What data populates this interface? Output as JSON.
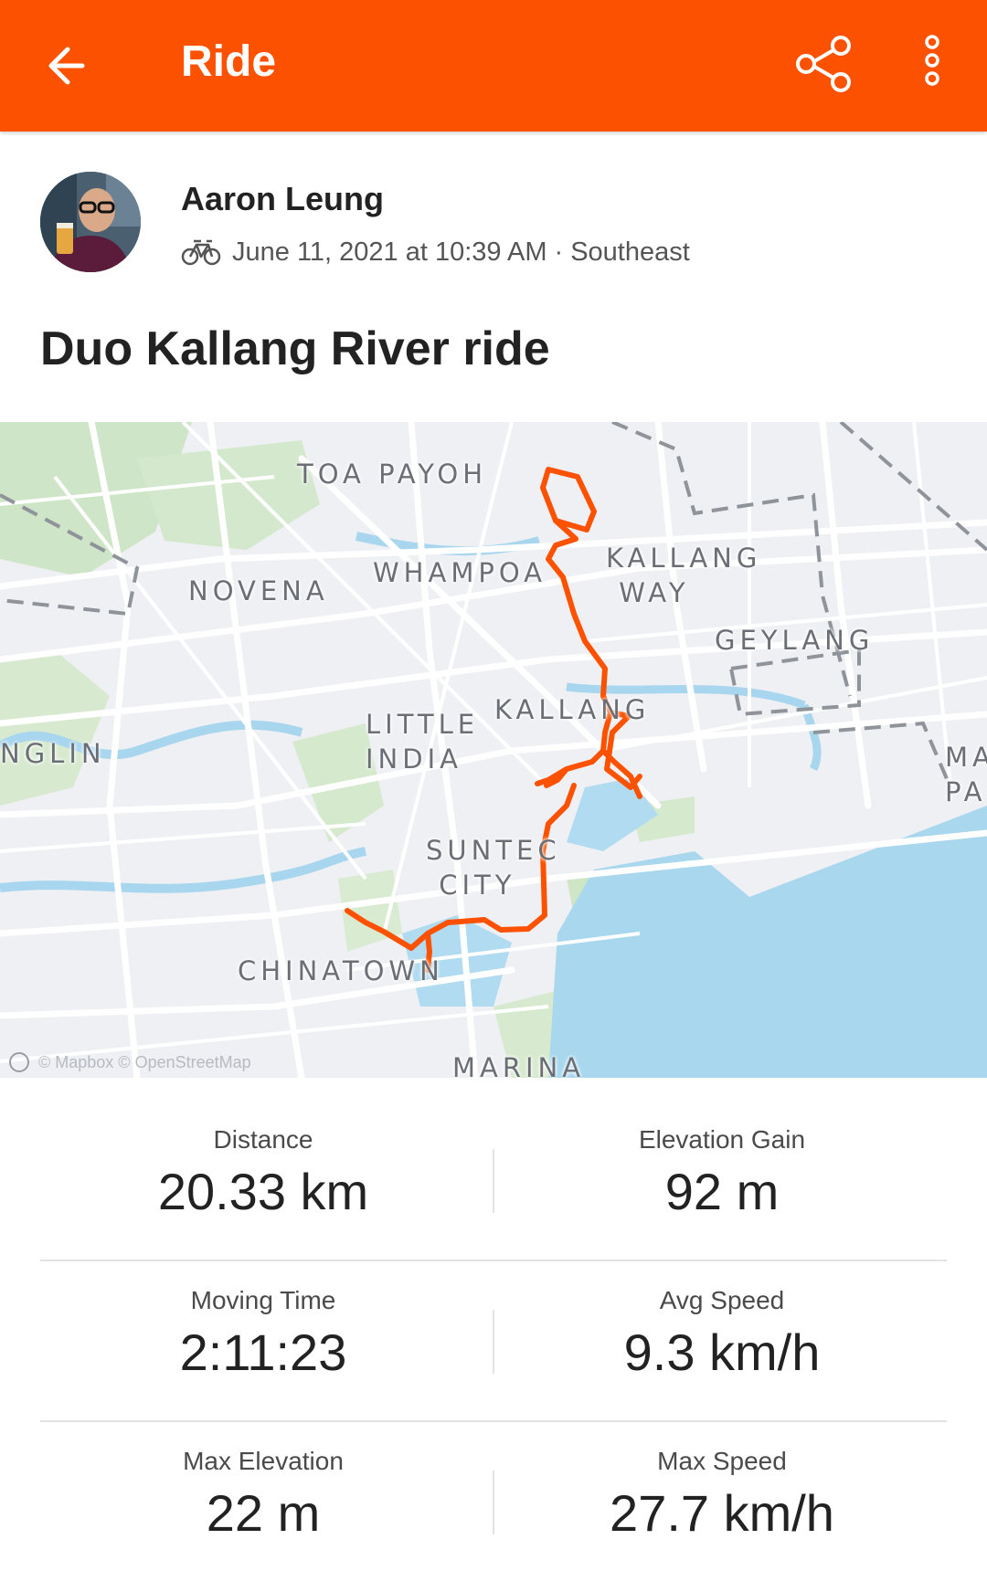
{
  "appbar": {
    "title": "Ride",
    "icons": [
      "back-arrow-icon",
      "share-icon",
      "more-vertical-icon"
    ],
    "color": "#fc5200"
  },
  "athlete": {
    "name": "Aaron Leung",
    "sport_icon": "bike-icon",
    "date": "June 11, 2021 at 10:39 AM",
    "separator": "·",
    "location": "Southeast"
  },
  "activity": {
    "title": "Duo Kallang River ride"
  },
  "map": {
    "labels": {
      "toa_payoh": "TOA PAYOH",
      "novena": "NOVENA",
      "whampoa": "WHAMPOA",
      "kallang_way": "KALLANG\n WAY",
      "geylang": "GEYLANG",
      "kallang": "KALLANG",
      "little_india": "LITTLE\nINDIA",
      "bukit_timah_edge": "NGLIN",
      "suntec_city": "SUNTEC\n CITY",
      "chinatown": "CHINATOWN",
      "marina_edge": "MARINA",
      "marine_parade_edge": "MA\nPA"
    },
    "credit": "© Mapbox © OpenStreetMap",
    "route_color": "#fc5200"
  },
  "stats": {
    "distance": {
      "label": "Distance",
      "value": "20.33 km"
    },
    "elevation_gain": {
      "label": "Elevation Gain",
      "value": "92 m"
    },
    "moving_time": {
      "label": "Moving Time",
      "value": "2:11:23"
    },
    "avg_speed": {
      "label": "Avg Speed",
      "value": "9.3 km/h"
    },
    "max_elevation": {
      "label": "Max Elevation",
      "value": "22 m"
    },
    "max_speed": {
      "label": "Max Speed",
      "value": "27.7 km/h"
    }
  }
}
